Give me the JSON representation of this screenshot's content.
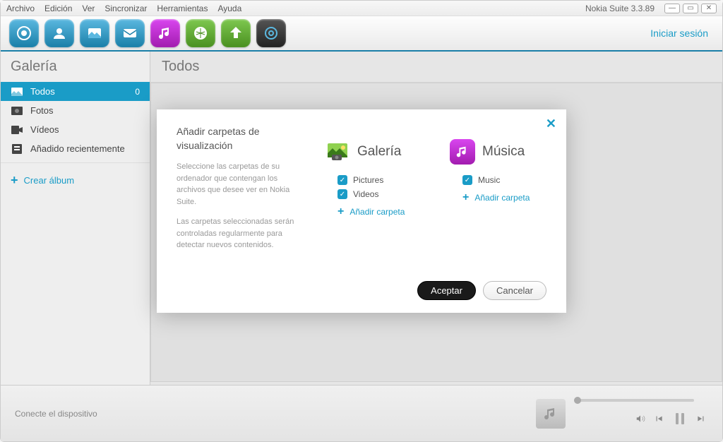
{
  "menubar": [
    "Archivo",
    "Edición",
    "Ver",
    "Sincronizar",
    "Herramientas",
    "Ayuda"
  ],
  "app_title": "Nokia Suite 3.3.89",
  "signin": "Iniciar sesión",
  "sidebar": {
    "title": "Galería",
    "items": [
      {
        "label": "Todos",
        "count": "0",
        "icon": "image"
      },
      {
        "label": "Fotos",
        "icon": "photo"
      },
      {
        "label": "Vídeos",
        "icon": "video"
      },
      {
        "label": "Añadido recientemente",
        "icon": "recent"
      }
    ],
    "create": "Crear álbum"
  },
  "main": {
    "title": "Todos"
  },
  "footer": {
    "status": "Conecte el dispositivo"
  },
  "modal": {
    "title": "Añadir carpetas de visualización",
    "desc1": "Seleccione las carpetas de su ordenador que contengan los archivos que desee ver en Nokia Suite.",
    "desc2": "Las carpetas seleccionadas serán controladas regularmente para detectar nuevos contenidos.",
    "gallery": {
      "title": "Galería",
      "items": [
        "Pictures",
        "Videos"
      ],
      "add": "Añadir carpeta"
    },
    "music": {
      "title": "Música",
      "items": [
        "Music"
      ],
      "add": "Añadir carpeta"
    },
    "accept": "Aceptar",
    "cancel": "Cancelar"
  }
}
